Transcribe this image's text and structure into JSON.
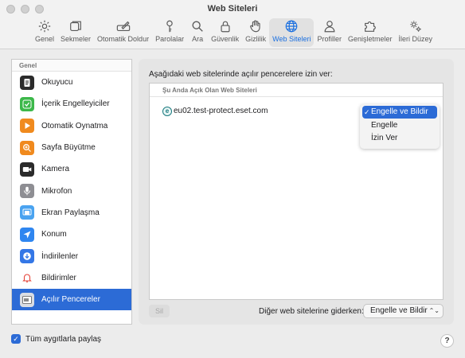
{
  "window": {
    "title": "Web Siteleri"
  },
  "toolbar": {
    "tabs": [
      {
        "label": "Genel",
        "icon": "gear-icon"
      },
      {
        "label": "Sekmeler",
        "icon": "tabs-icon"
      },
      {
        "label": "Otomatik Doldur",
        "icon": "autofill-pen-icon"
      },
      {
        "label": "Parolalar",
        "icon": "key-icon"
      },
      {
        "label": "Ara",
        "icon": "magnifier-icon"
      },
      {
        "label": "Güvenlik",
        "icon": "lock-icon"
      },
      {
        "label": "Gizlilik",
        "icon": "hand-icon"
      },
      {
        "label": "Web Siteleri",
        "icon": "globe-icon",
        "active": true
      },
      {
        "label": "Profiller",
        "icon": "person-icon"
      },
      {
        "label": "Genişletmeler",
        "icon": "puzzle-icon"
      },
      {
        "label": "İleri Düzey",
        "icon": "gears-icon"
      }
    ]
  },
  "sidebar": {
    "header": "Genel",
    "items": [
      {
        "label": "Okuyucu",
        "icon": "reader-icon"
      },
      {
        "label": "İçerik Engelleyiciler",
        "icon": "checkmark-shield-icon"
      },
      {
        "label": "Otomatik Oynatma",
        "icon": "play-icon"
      },
      {
        "label": "Sayfa Büyütme",
        "icon": "zoom-icon"
      },
      {
        "label": "Kamera",
        "icon": "camera-icon"
      },
      {
        "label": "Mikrofon",
        "icon": "microphone-icon"
      },
      {
        "label": "Ekran Paylaşma",
        "icon": "screen-share-icon"
      },
      {
        "label": "Konum",
        "icon": "location-arrow-icon"
      },
      {
        "label": "İndirilenler",
        "icon": "download-icon"
      },
      {
        "label": "Bildirimler",
        "icon": "bell-icon"
      },
      {
        "label": "Açılır Pencereler",
        "icon": "popup-window-icon",
        "active": true
      }
    ]
  },
  "main": {
    "title": "Aşağıdaki web sitelerinde açılır pencerelere izin ver:",
    "table": {
      "header": "Şu Anda Açık Olan Web Siteleri",
      "rows": [
        {
          "site": "eu02.test-protect.eset.com",
          "icon_letter": "e",
          "value": "Engelle ve Bildir"
        }
      ]
    },
    "dropdown": {
      "options": [
        "Engelle ve Bildir",
        "Engelle",
        "İzin Ver"
      ],
      "selected": "Engelle ve Bildir",
      "check": "✓"
    },
    "remove_button": "Sil",
    "other_sites_label": "Diğer web sitelerine giderken:",
    "other_sites_value": "Engelle ve Bildir"
  },
  "footer": {
    "share_label": "Tüm aygıtlarla paylaş",
    "share_checked": true,
    "help": "?"
  },
  "colors": {
    "accent": "#2c6bd6",
    "active_tab_text": "#1a6fe0"
  }
}
